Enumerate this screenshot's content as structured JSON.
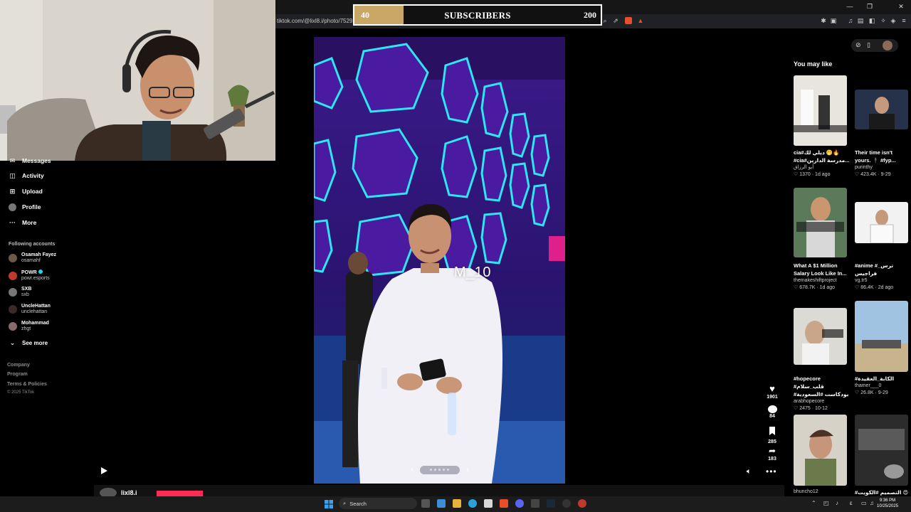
{
  "browser": {
    "url": "tiktok.com/@lixl8.i/photo/752922",
    "window_controls": [
      "—",
      "❐",
      "✕"
    ]
  },
  "subscriber_goal": {
    "label": "SUBSCRIBERS",
    "current": "40",
    "target": "200",
    "progress_fraction": 0.2,
    "fill_color": "#c9a766"
  },
  "sidebar": {
    "nav": [
      {
        "label": "Messages",
        "icon": "messages-icon"
      },
      {
        "label": "Activity",
        "icon": "activity-icon"
      },
      {
        "label": "Upload",
        "icon": "upload-icon"
      },
      {
        "label": "Profile",
        "icon": "profile-icon"
      },
      {
        "label": "More",
        "icon": "more-icon"
      }
    ],
    "following_title": "Following accounts",
    "accounts": [
      {
        "name": "Osamah Fayez",
        "handle": "osamahf",
        "color": "#6b5a4a"
      },
      {
        "name": "POWR",
        "handle": "powr.esports",
        "color": "#c0392b"
      },
      {
        "name": "SXB",
        "handle": "sxb",
        "color": "#777777"
      },
      {
        "name": "UncleHattan",
        "handle": "unclehattan",
        "color": "#3a2a2a"
      },
      {
        "name": "Mohammad",
        "handle": "zhgt",
        "color": "#8a6b6b"
      }
    ],
    "see_more": "See more",
    "footer": [
      "Company",
      "Program",
      "Terms & Policies",
      "© 2025 TikTok"
    ]
  },
  "post": {
    "watermark": "M_10",
    "bottom_username": "lixl8.i",
    "actions": [
      {
        "icon": "heart-icon",
        "count": "1901"
      },
      {
        "icon": "comment-icon",
        "count": "84"
      },
      {
        "icon": "bookmark-icon",
        "count": "285"
      },
      {
        "icon": "share-icon",
        "count": "183"
      }
    ]
  },
  "you_may_like": {
    "title": "You may like",
    "cards": [
      {
        "title1": "cia#ديلي لك 🤭🔥",
        "title2": "#cia#مدرسة الدارين...",
        "user": "أبو الرزاق",
        "likes": "1370",
        "date": "1d ago"
      },
      {
        "title1": "Their time isn't",
        "title2": "yours. 🕴 #fyp...",
        "user": "purinthy",
        "likes": "423.4K",
        "date": "9-29"
      },
      {
        "title1": "What A $1 Million",
        "title2": "Salary Look Like In...",
        "user": "themakeshiftproject",
        "likes": "678.7K",
        "date": "1d ago"
      },
      {
        "title1": "#anime #ترس_ فراجيس",
        "title2": "",
        "user": "vg.tr5",
        "likes": "86.4K",
        "date": "2d ago"
      },
      {
        "title1": "#hopecore #قلب_سلام",
        "title2": "#بودكاست #السعودية",
        "user": "arabhopecore",
        "likes": "2475",
        "date": "10-12"
      },
      {
        "title1": "#الكابة_العقيدة",
        "title2": "",
        "user": "thamer___0",
        "likes": "26.8K",
        "date": "9-29"
      },
      {
        "title1": "",
        "title2": "",
        "user": "bhuncho12",
        "likes": "",
        "date": ""
      },
      {
        "title1": "#التصميم #الكويت 😍",
        "title2": "",
        "user": "",
        "likes": "",
        "date": ""
      }
    ]
  },
  "taskbar": {
    "search_placeholder": "Search",
    "time": "9:36 PM",
    "date": "10/25/2025"
  }
}
